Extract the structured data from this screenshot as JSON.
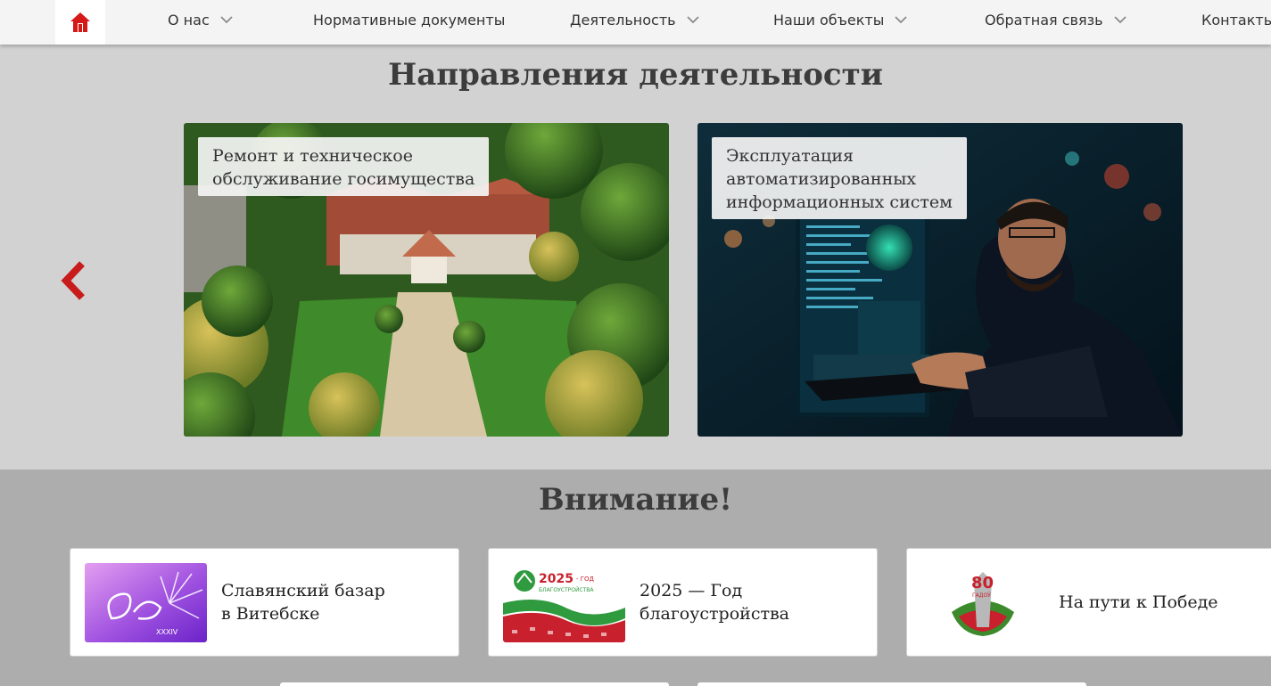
{
  "nav": {
    "home_icon": "home-icon",
    "items": [
      {
        "label": "О нас",
        "has_dropdown": true
      },
      {
        "label": "Нормативные документы",
        "has_dropdown": false
      },
      {
        "label": "Деятельность",
        "has_dropdown": true
      },
      {
        "label": "Наши объекты",
        "has_dropdown": true
      },
      {
        "label": "Обратная связь",
        "has_dropdown": true
      },
      {
        "label": "Контакты",
        "has_dropdown": false
      }
    ]
  },
  "activity": {
    "title": "Направления деятельности",
    "cards": [
      {
        "line1": "Ремонт и техническое",
        "line2": "обслуживание госимущества"
      },
      {
        "line1": "Эксплуатация",
        "line2": "автоматизированных",
        "line3": "информационных систем"
      }
    ]
  },
  "attention": {
    "title": "Внимание!",
    "banners": [
      {
        "line1": "Славянский базар",
        "line2": "в Витебске",
        "logo_caption": "XXXIV"
      },
      {
        "line1": "2025 — Год",
        "line2": "благоустройства",
        "logo_year": "2025",
        "logo_suffix": "- ГОД",
        "logo_word": "БЛАГОУСТРОЙСТВА"
      },
      {
        "line1": "На пути к Победе",
        "logo_number": "80",
        "logo_word": "ГАДОЎ"
      }
    ]
  },
  "colors": {
    "accent": "#d51818",
    "nav_bg": "#f5f4f4",
    "section_bg": "#d2d2d2",
    "attention_bg": "#adadad"
  }
}
